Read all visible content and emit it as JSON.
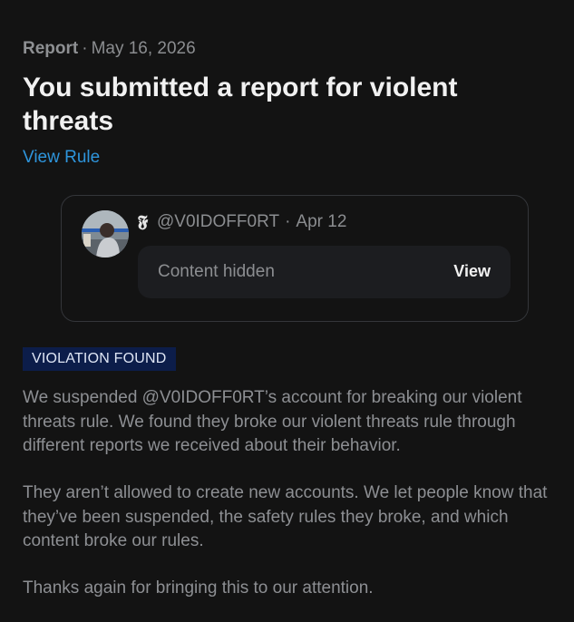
{
  "report": {
    "kind": "Report",
    "separator": "·",
    "date": "May 16, 2026",
    "title": "You submitted a report for violent threats",
    "view_rule": "View Rule"
  },
  "post": {
    "handle": "@V0IDOFF0RT",
    "separator": "·",
    "date": "Apr 12",
    "hidden_label": "Content hidden",
    "view_label": "View",
    "badge_icon": "fraktur-f-icon"
  },
  "result": {
    "badge": "VIOLATION FOUND",
    "paragraphs": [
      "We suspended @V0IDOFF0RT’s account for breaking our violent threats rule. We found they broke our violent threats rule through different reports we received about their behavior.",
      "They aren’t allowed to create new accounts. We let people know that they’ve been suspended, the safety rules they broke, and which content broke our rules.",
      "Thanks again for bringing this to our attention."
    ]
  },
  "colors": {
    "background": "#131313",
    "link": "#2e95dc",
    "badge_bg": "#0c1d4a"
  }
}
